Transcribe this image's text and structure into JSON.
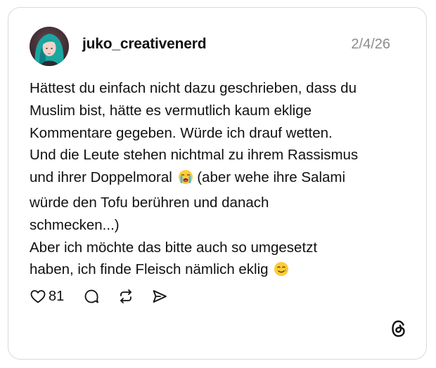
{
  "post": {
    "username": "juko_creativenerd",
    "date": "2/4/26",
    "lines": [
      "Hättest du einfach nicht dazu geschrieben, dass du",
      "Muslim bist, hätte es vermutlich kaum eklige",
      "Kommentare gegeben. Würde ich drauf wetten.",
      "Und die Leute stehen nichtmal zu ihrem Rassismus",
      "und ihrer Doppelmoral",
      "(aber wehe ihre Salami",
      "würde den Tofu berühren und danach",
      "schmecken...)",
      "Aber ich möchte das bitte auch so umgesetzt",
      "haben, ich finde Fleisch nämlich eklig"
    ],
    "emojis": [
      "loudly-crying-face-emoji",
      "smiling-face-with-tear-emoji"
    ]
  },
  "actions": {
    "like_count": "81",
    "icons": [
      "heart-icon",
      "comment-icon",
      "repost-icon",
      "share-icon"
    ]
  },
  "brand": {
    "logo": "threads-logo",
    "text_color": "#111111",
    "muted_color": "#8c8c8c",
    "border_color": "#d9d9d9"
  }
}
